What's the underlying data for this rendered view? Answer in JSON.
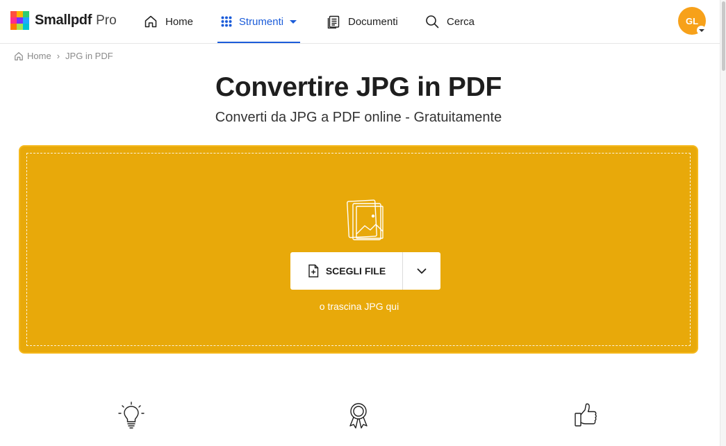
{
  "app": {
    "brand": "Smallpdf",
    "plan": "Pro",
    "logo_colors": [
      "#ff4f3f",
      "#ffb400",
      "#2ecc71",
      "#ff2d8a",
      "#7b2fff",
      "#1ea7ff",
      "#ff7a00",
      "#a9e34b",
      "#00c2d1"
    ]
  },
  "nav": {
    "home": {
      "label": "Home",
      "icon": "home-icon"
    },
    "tools": {
      "label": "Strumenti",
      "icon": "grid-icon",
      "active": true
    },
    "documents": {
      "label": "Documenti",
      "icon": "document-icon"
    },
    "search": {
      "label": "Cerca",
      "icon": "search-icon"
    }
  },
  "user": {
    "initials": "GL",
    "avatar_color": "#f7a11a"
  },
  "breadcrumb": {
    "home": "Home",
    "current": "JPG in PDF",
    "separator": "›"
  },
  "page": {
    "title": "Convertire JPG in PDF",
    "subtitle": "Converti da JPG a PDF online - Gratuitamente"
  },
  "dropzone": {
    "button_label": "SCEGLI FILE",
    "hint": "o trascina JPG qui",
    "background": "#e8a90a",
    "border": "#f5b81b"
  },
  "features": [
    {
      "icon": "lightbulb-icon"
    },
    {
      "icon": "award-ribbon-icon"
    },
    {
      "icon": "thumbs-up-icon"
    }
  ],
  "colors": {
    "accent": "#1b5cd9",
    "text": "#1e1e1e",
    "muted": "#8a8a8a"
  }
}
